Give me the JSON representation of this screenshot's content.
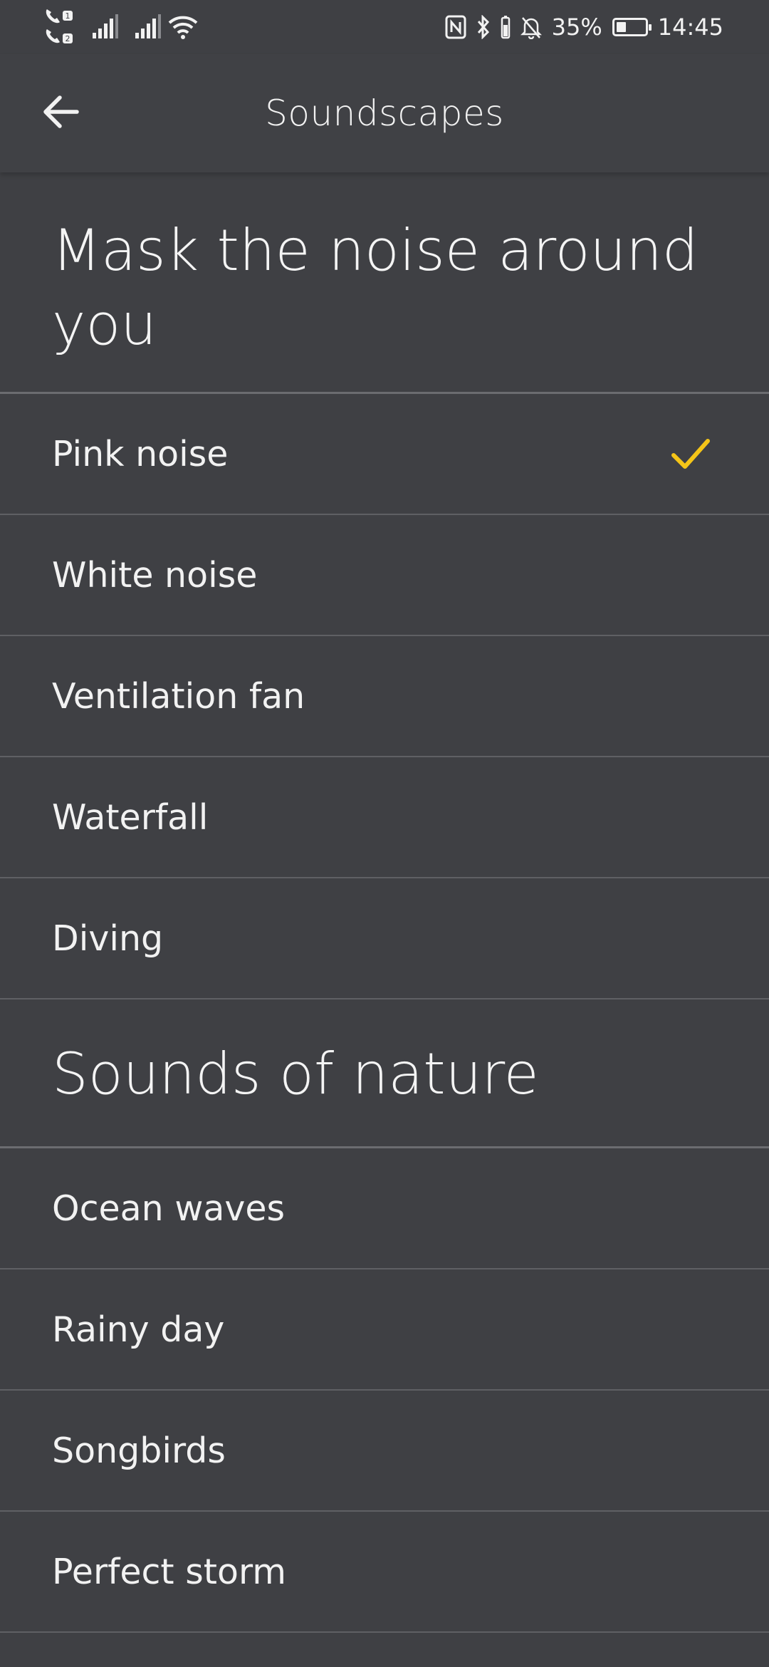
{
  "status_bar": {
    "battery_percent": "35%",
    "battery_level": 0.35,
    "time": "14:45",
    "icons": [
      "wifi-call-sim1-icon",
      "wifi-call-sim2-icon",
      "signal-sim1-icon",
      "signal-sim2-icon",
      "wifi-icon",
      "nfc-icon",
      "bluetooth-icon",
      "mute-icon",
      "battery-icon"
    ]
  },
  "header": {
    "back_icon": "arrow-left-icon",
    "title": "Soundscapes"
  },
  "sections": [
    {
      "heading": "Mask the noise around you",
      "items": [
        {
          "label": "Pink noise",
          "selected": true
        },
        {
          "label": "White noise",
          "selected": false
        },
        {
          "label": "Ventilation fan",
          "selected": false
        },
        {
          "label": "Waterfall",
          "selected": false
        },
        {
          "label": "Diving",
          "selected": false
        }
      ]
    },
    {
      "heading": "Sounds of nature",
      "items": [
        {
          "label": "Ocean waves",
          "selected": false
        },
        {
          "label": "Rainy day",
          "selected": false
        },
        {
          "label": "Songbirds",
          "selected": false
        },
        {
          "label": "Perfect storm",
          "selected": false
        }
      ]
    }
  ],
  "colors": {
    "background": "#3f4044",
    "accent_check": "#f5c518",
    "divider": "#5f6064",
    "text": "#f2f2f2"
  }
}
